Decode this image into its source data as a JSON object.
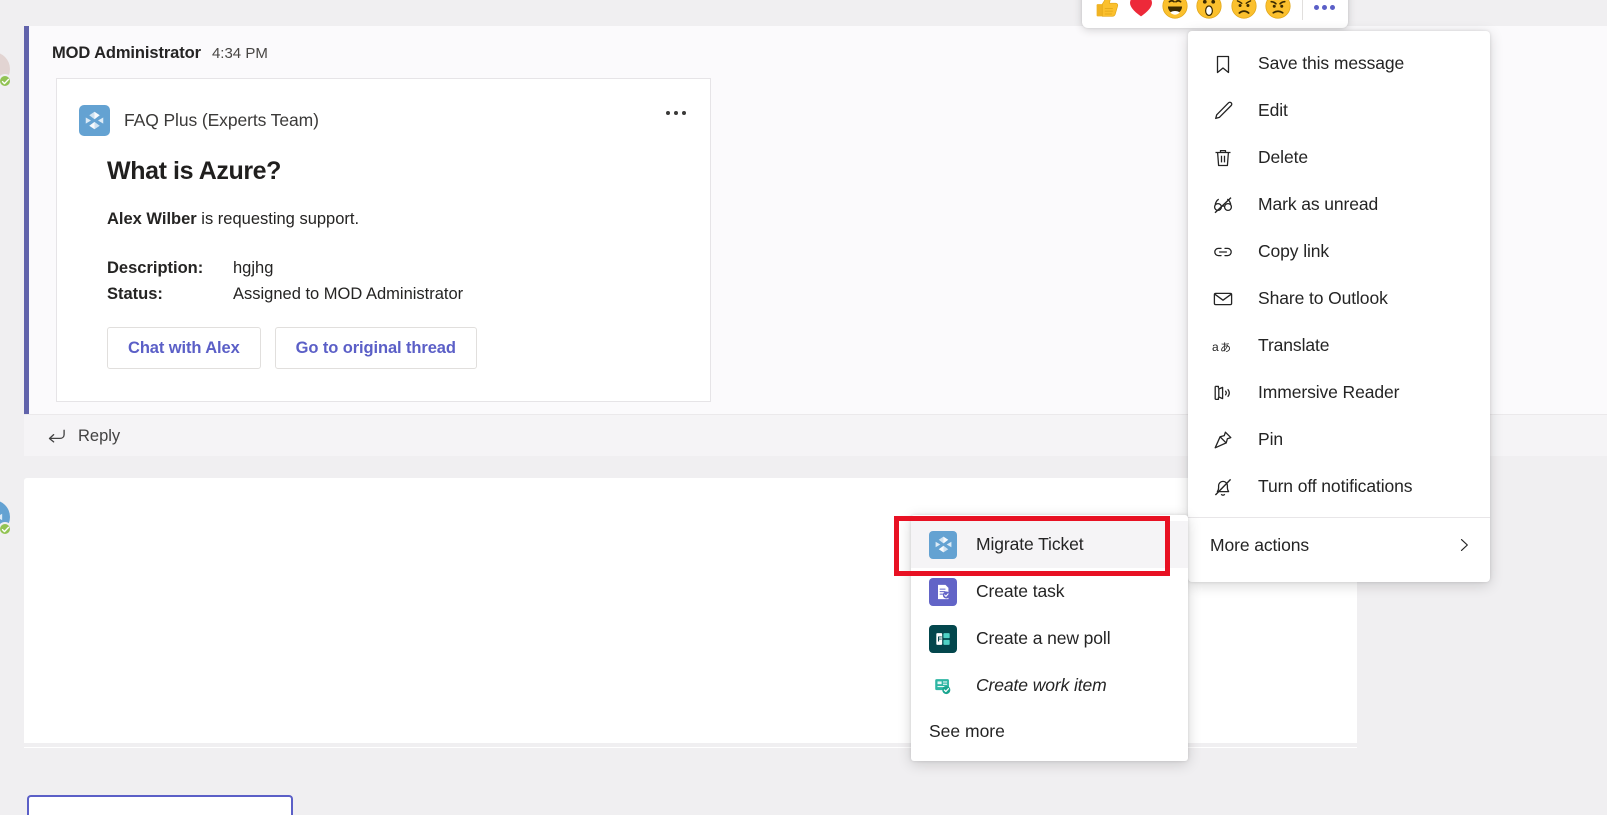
{
  "message": {
    "author": "MOD Administrator",
    "timestamp": "4:34 PM",
    "reply_label": "Reply",
    "reply_icon": "reply-arrow-icon",
    "accent_color": "#6163ab"
  },
  "card": {
    "app_name": "FAQ Plus (Experts Team)",
    "app_icon": "faq-plus-app-icon",
    "title": "What is Azure?",
    "subtitle_name": "Alex Wilber",
    "subtitle_rest": " is requesting support.",
    "facts": [
      {
        "key": "Description:",
        "value": "hgjhg"
      },
      {
        "key": "Status:",
        "value": "Assigned to MOD Administrator"
      }
    ],
    "buttons": [
      {
        "label": "Chat with Alex",
        "name": "chat-with-alex-button"
      },
      {
        "label": "Go to original thread",
        "name": "go-to-original-thread-button"
      }
    ],
    "overflow_icon": "more-options-icon",
    "link_color": "#5b5fc7"
  },
  "reactions": {
    "items": [
      {
        "name": "thumbs-up-reaction",
        "label": "Like"
      },
      {
        "name": "heart-reaction",
        "label": "Heart"
      },
      {
        "name": "laugh-reaction",
        "label": "Laugh"
      },
      {
        "name": "surprised-reaction",
        "label": "Surprised"
      },
      {
        "name": "sad-reaction",
        "label": "Sad"
      },
      {
        "name": "angry-reaction",
        "label": "Angry"
      }
    ],
    "more_label": "More reactions",
    "more_icon": "more-options-icon"
  },
  "context_menu": {
    "items": [
      {
        "label": "Save this message",
        "icon": "bookmark-icon"
      },
      {
        "label": "Edit",
        "icon": "pencil-icon"
      },
      {
        "label": "Delete",
        "icon": "trash-icon"
      },
      {
        "label": "Mark as unread",
        "icon": "glasses-slash-icon"
      },
      {
        "label": "Copy link",
        "icon": "link-icon"
      },
      {
        "label": "Share to Outlook",
        "icon": "envelope-icon"
      },
      {
        "label": "Translate",
        "icon": "translate-icon"
      },
      {
        "label": "Immersive Reader",
        "icon": "immersive-reader-icon"
      },
      {
        "label": "Pin",
        "icon": "pin-icon"
      },
      {
        "label": "Turn off notifications",
        "icon": "bell-slash-icon"
      }
    ],
    "more_actions": {
      "label": "More actions",
      "chevron_icon": "chevron-right-icon"
    }
  },
  "app_submenu": {
    "items": [
      {
        "label": "Migrate Ticket",
        "icon": "faq-plus-app-icon",
        "selected": true,
        "italic": false
      },
      {
        "label": "Create task",
        "icon": "planner-task-icon",
        "selected": false,
        "italic": false
      },
      {
        "label": "Create a new poll",
        "icon": "forms-poll-icon",
        "selected": false,
        "italic": false
      },
      {
        "label": "Create work item",
        "icon": "work-item-icon",
        "selected": false,
        "italic": true
      }
    ],
    "see_more_label": "See more"
  },
  "annotation": {
    "color": "#e81123",
    "target": "Migrate Ticket"
  }
}
